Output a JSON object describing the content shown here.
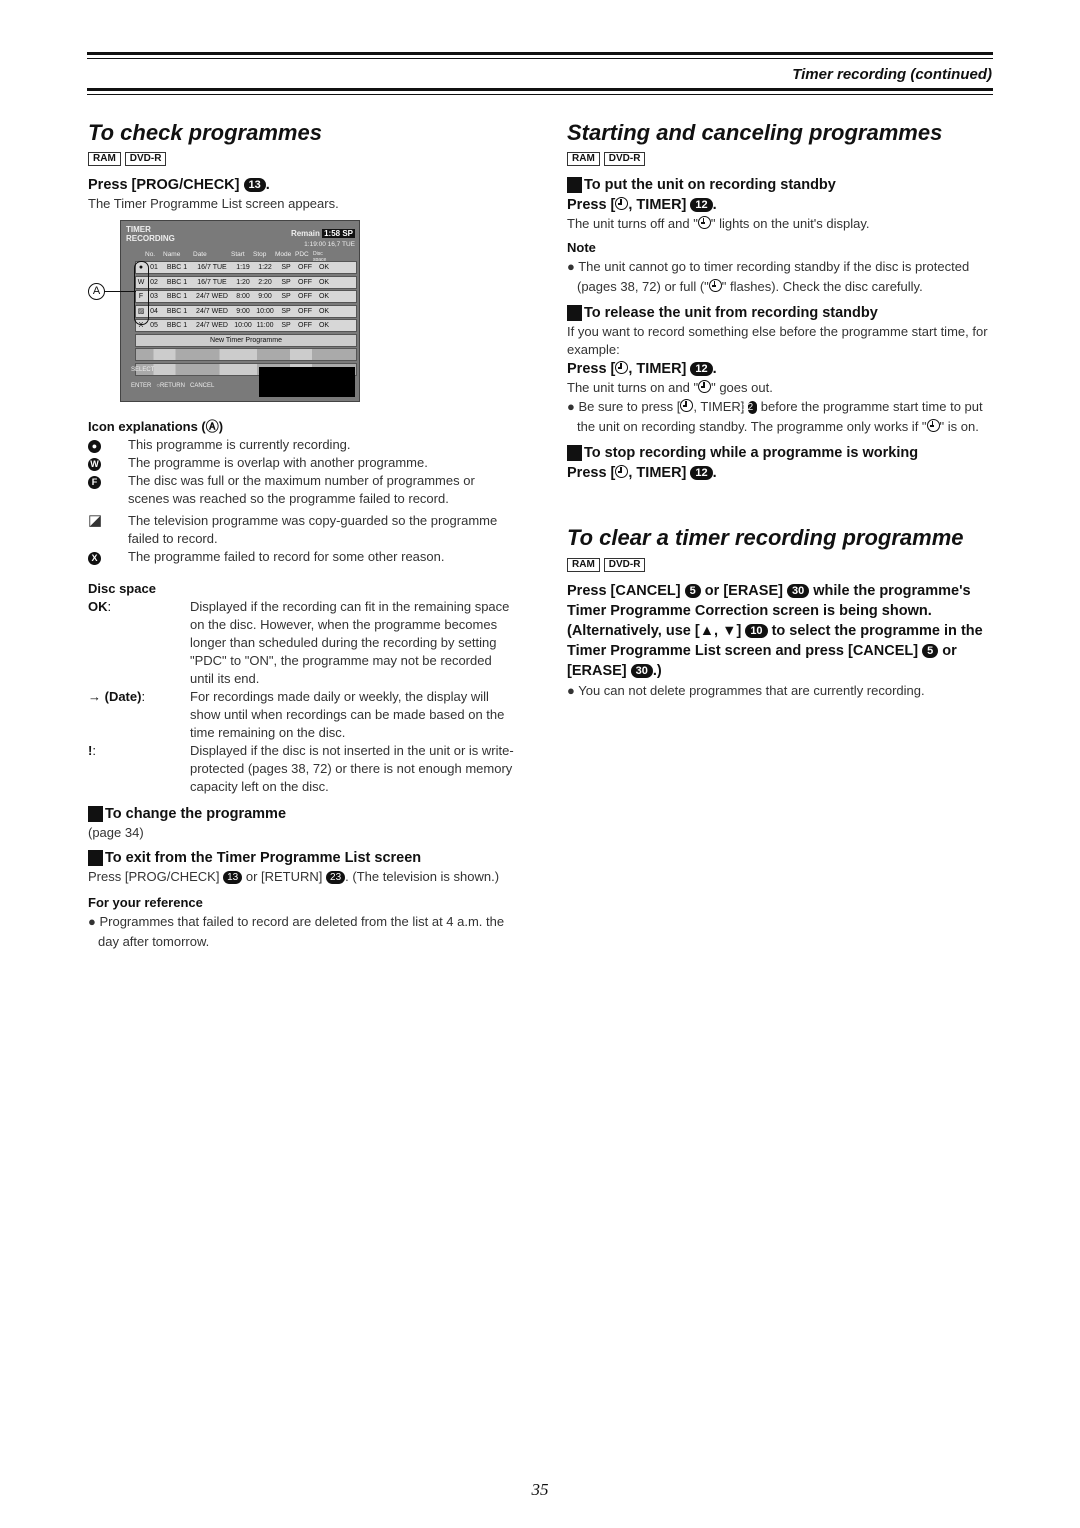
{
  "running_head": "Timer recording (continued)",
  "page_number": "35",
  "left": {
    "check": {
      "title": "To check programmes",
      "badges": [
        "RAM",
        "DVD-R"
      ],
      "press_label": "Press [PROG/CHECK]",
      "press_button_num": "13",
      "press_suffix": ".",
      "desc": "The Timer Programme List screen appears."
    },
    "tv_screen": {
      "title_line1": "TIMER",
      "title_line2": "RECORDING",
      "remain_label": "Remain",
      "remain_value": "1:58 SP",
      "clock": "1:19:00   16,7 TUE",
      "columns": [
        "No.",
        "Name",
        "Date",
        "Start",
        "Stop",
        "Mode",
        "PDC",
        "Disc space"
      ],
      "rows": [
        {
          "icon": "●",
          "no": "01",
          "name": "BBC 1",
          "date": "16/7 TUE",
          "start": "1:19",
          "stop": "1:22",
          "mode": "SP",
          "pdc": "OFF",
          "space": "OK"
        },
        {
          "icon": "W",
          "no": "02",
          "name": "BBC 1",
          "date": "16/7 TUE",
          "start": "1:20",
          "stop": "2:20",
          "mode": "SP",
          "pdc": "OFF",
          "space": "OK"
        },
        {
          "icon": "F",
          "no": "03",
          "name": "BBC 1",
          "date": "24/7 WED",
          "start": "8:00",
          "stop": "9:00",
          "mode": "SP",
          "pdc": "OFF",
          "space": "OK"
        },
        {
          "icon": "▨",
          "no": "04",
          "name": "BBC 1",
          "date": "24/7 WED",
          "start": "9:00",
          "stop": "10:00",
          "mode": "SP",
          "pdc": "OFF",
          "space": "OK"
        },
        {
          "icon": "X",
          "no": "05",
          "name": "BBC 1",
          "date": "24/7 WED",
          "start": "10:00",
          "stop": "11:00",
          "mode": "SP",
          "pdc": "OFF",
          "space": "OK"
        }
      ],
      "new_programme": "New Timer Programme",
      "ctrl_select": "SELECT",
      "ctrl_enter": "ENTER",
      "ctrl_return": "RETURN",
      "ctrl_cancel": "CANCEL",
      "marker": "A"
    },
    "icons": {
      "heading": "Icon explanations (Ⓐ)",
      "items": [
        {
          "glyph": "●",
          "text": "This programme is currently recording."
        },
        {
          "glyph": "W",
          "text": "The programme is overlap with another programme."
        },
        {
          "glyph": "F",
          "text": "The disc was full or the maximum number of programmes or scenes was reached so the programme failed to record."
        },
        {
          "glyph": "◪",
          "text": "The television programme was copy-guarded so the programme failed to record."
        },
        {
          "glyph": "X",
          "text": "The programme failed to record for some other reason."
        }
      ]
    },
    "disc_space": {
      "heading": "Disc space",
      "items": [
        {
          "key": "OK",
          "sep": ":",
          "text": "Displayed if the recording can fit in the remaining space on the disc. However, when the programme becomes longer than scheduled during the recording by setting \"PDC\" to \"ON\", the programme may not be recorded until its end."
        },
        {
          "key": "→ (Date)",
          "sep": ":",
          "text": "For recordings made daily or weekly, the display will show until when recordings can be made based on the time remaining on the disc."
        },
        {
          "key": "!",
          "sep": ":",
          "text": "Displayed if the disc is not inserted in the unit or is write-protected (pages 38, 72) or there is not enough memory capacity left on the disc."
        }
      ]
    },
    "change": {
      "heading": "To change the programme",
      "text": "(page 34)"
    },
    "exit": {
      "heading": "To exit from the Timer Programme List screen",
      "text_a": "Press [PROG/CHECK]",
      "num_a": "13",
      "text_b": "or [RETURN]",
      "num_b": "23",
      "text_c": ". (The television is shown.)"
    },
    "reference": {
      "heading": "For your reference",
      "bullet": "Programmes that failed to record are deleted from the list at 4 a.m. the day after tomorrow."
    }
  },
  "right": {
    "starting": {
      "title": "Starting and canceling programmes",
      "badges": [
        "RAM",
        "DVD-R"
      ],
      "standby_heading": "To put the unit on recording standby",
      "press_prefix": "Press [",
      "press_suffix": ", TIMER]",
      "button_num": "12",
      "standby_desc_a": "The unit turns off and \"",
      "standby_desc_b": "\" lights on the unit's display.",
      "note_heading": "Note",
      "note_a": "The unit cannot go to timer recording standby if the disc is protected (pages 38, 72) or full (\"",
      "note_b": "\" flashes). Check the disc carefully.",
      "release_heading": "To release the unit from recording standby",
      "release_desc": "If you want to record something else before the programme start time, for example:",
      "release_result_a": "The unit turns on and \"",
      "release_result_b": "\" goes out.",
      "bullet_a": "Be sure to press [",
      "bullet_b": ", TIMER]",
      "bullet_c": "before the programme start time to put the unit on recording standby. The programme only works if \"",
      "bullet_d": "\" is on.",
      "stop_heading": "To stop recording while a programme is working"
    },
    "clear": {
      "title": "To clear a timer recording programme",
      "badges": [
        "RAM",
        "DVD-R"
      ],
      "p1_a": "Press [CANCEL]",
      "cancel_num": "5",
      "p1_b": "or [ERASE]",
      "erase_num": "30",
      "p1_c": "while the programme's Timer Programme Correction screen is being shown.",
      "p2_a": "(Alternatively, use [▲, ▼]",
      "arrow_num": "10",
      "p2_b": "to select the programme in the Timer Programme List screen and press [CANCEL]",
      "p2_c": "or [ERASE]",
      "p2_d": ".)",
      "bullet": "You can not delete programmes that are currently recording."
    }
  }
}
